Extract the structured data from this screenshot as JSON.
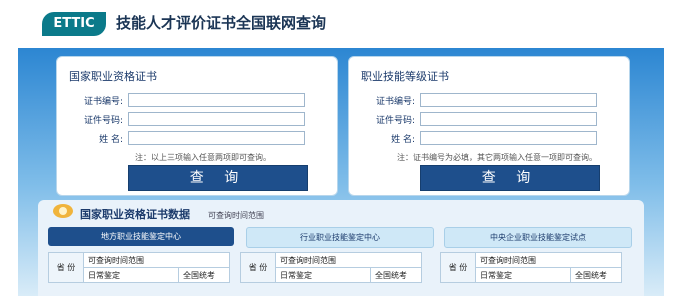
{
  "header": {
    "logo_text": "ETTIC",
    "title": "技能人才评价证书全国联网查询"
  },
  "card_left": {
    "title": "国家职业资格证书",
    "labels": [
      "证书编号:",
      "证件号码:",
      "姓    名:"
    ],
    "note": "注：以上三项输入任意两项即可查询。",
    "button": "查 询"
  },
  "card_right": {
    "title": "职业技能等级证书",
    "labels": [
      "证书编号:",
      "证件号码:",
      "姓    名:"
    ],
    "note": "注：证书编号为必填，其它两项输入任意一项即可查询。",
    "button": "查 询"
  },
  "data_panel": {
    "title": "国家职业资格证书数据",
    "subtitle": "可查询时间范围",
    "tabs": [
      "地方职业技能鉴定中心",
      "行业职业技能鉴定中心",
      "中央企业职业技能鉴定试点"
    ],
    "table": {
      "province": "省 份",
      "range": "可查询时间范围",
      "col1": "日常鉴定",
      "col2": "全国统考"
    }
  }
}
